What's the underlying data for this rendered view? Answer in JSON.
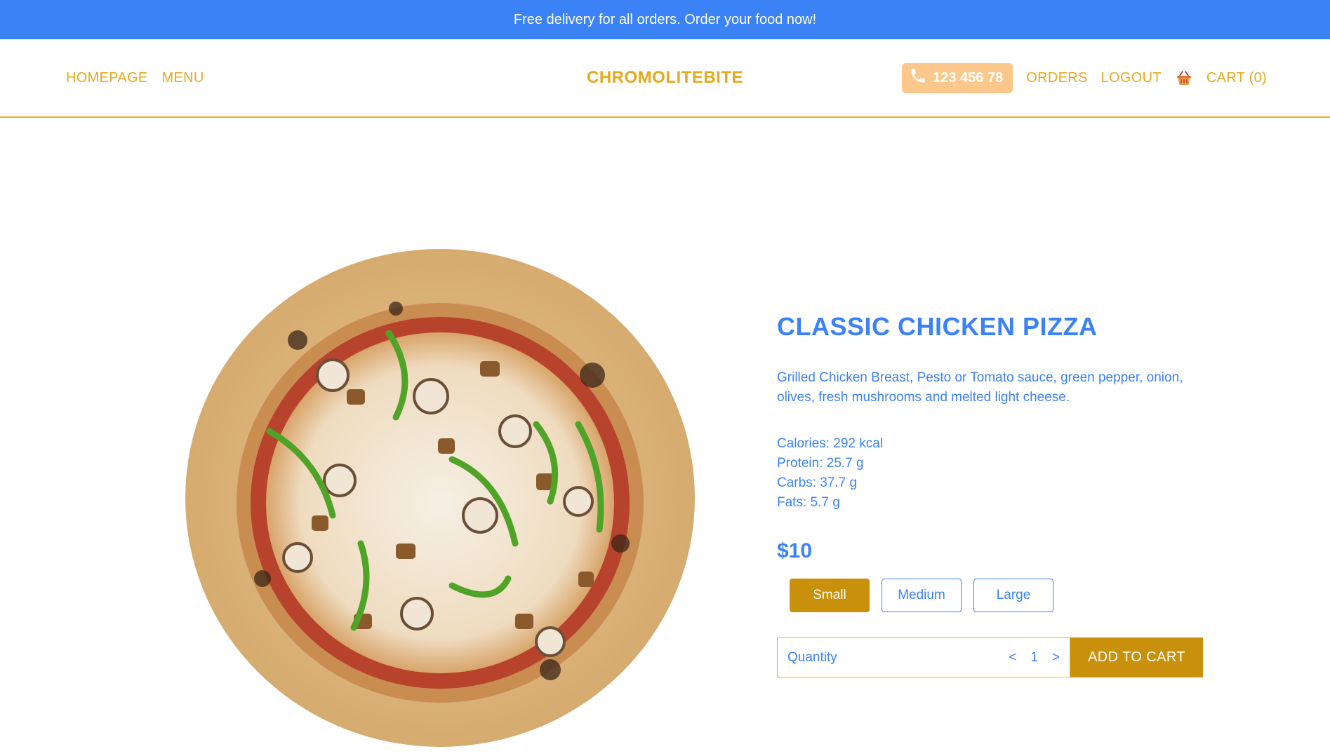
{
  "promo": {
    "text": "Free delivery for all orders. Order your food now!"
  },
  "nav": {
    "left_links": [
      "HOMEPAGE",
      "MENU"
    ],
    "brand": "CHROMOLITEBITE",
    "phone": "123 456 78",
    "orders": "ORDERS",
    "logout": "LOGOUT",
    "cart": "CART (0)"
  },
  "colors": {
    "accent_blue": "#3b82f6",
    "accent_gold": "#e5a91c",
    "button_gold": "#c8900b",
    "phone_pill": "#fcc78a"
  },
  "icons": {
    "phone": "phone-icon",
    "basket": "basket-icon"
  },
  "product": {
    "title": "CLASSIC CHICKEN PIZZA",
    "description": "Grilled Chicken Breast, Pesto or Tomato sauce, green pepper, onion, olives, fresh mushrooms and melted light cheese.",
    "nutrition": {
      "calories": "Calories: 292 kcal",
      "protein": "Protein: 25.7 g",
      "carbs": "Carbs: 37.7 g",
      "fats": "Fats: 5.7 g"
    },
    "price": "$10",
    "sizes": [
      "Small",
      "Medium",
      "Large"
    ],
    "selected_size": "Small",
    "quantity_label": "Quantity",
    "quantity_decrement": "<",
    "quantity_value": "1",
    "quantity_increment": ">",
    "add_to_cart": "ADD TO CART"
  }
}
